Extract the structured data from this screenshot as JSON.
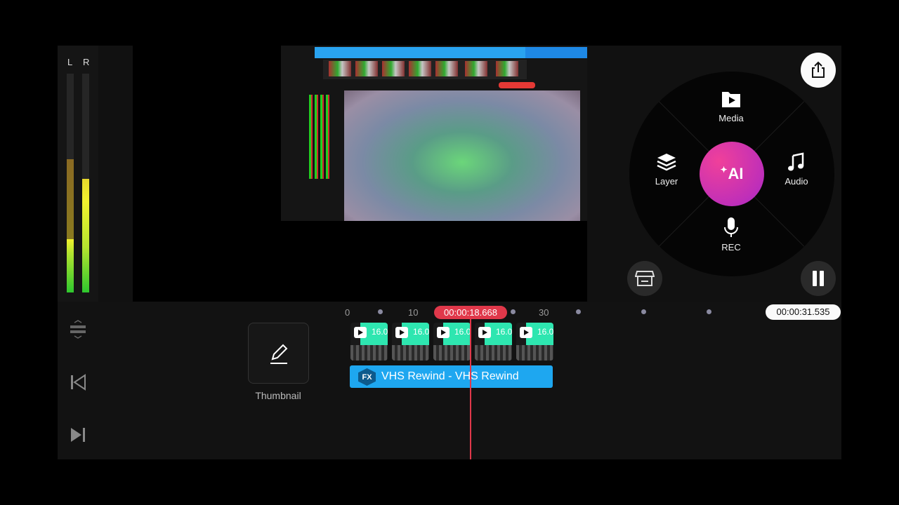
{
  "meter": {
    "left_label": "L",
    "right_label": "R",
    "left_level": 0.61,
    "right_level": 0.52,
    "left_peak": 0.61,
    "right_peak": 0.52
  },
  "wheel": {
    "media_label": "Media",
    "layer_label": "Layer",
    "audio_label": "Audio",
    "rec_label": "REC",
    "ai_label": "AI",
    "accent_color": "#e0389a"
  },
  "timeline": {
    "ruler": [
      "0",
      "10",
      "30"
    ],
    "playhead_time": "00:00:18.668",
    "total_time": "00:00:31.535",
    "thumbnail_label": "Thumbnail",
    "clip_number": "16.0",
    "fx_badge": "FX",
    "fx_label": "VHS Rewind - VHS Rewind",
    "playhead_color": "#e0384a"
  }
}
